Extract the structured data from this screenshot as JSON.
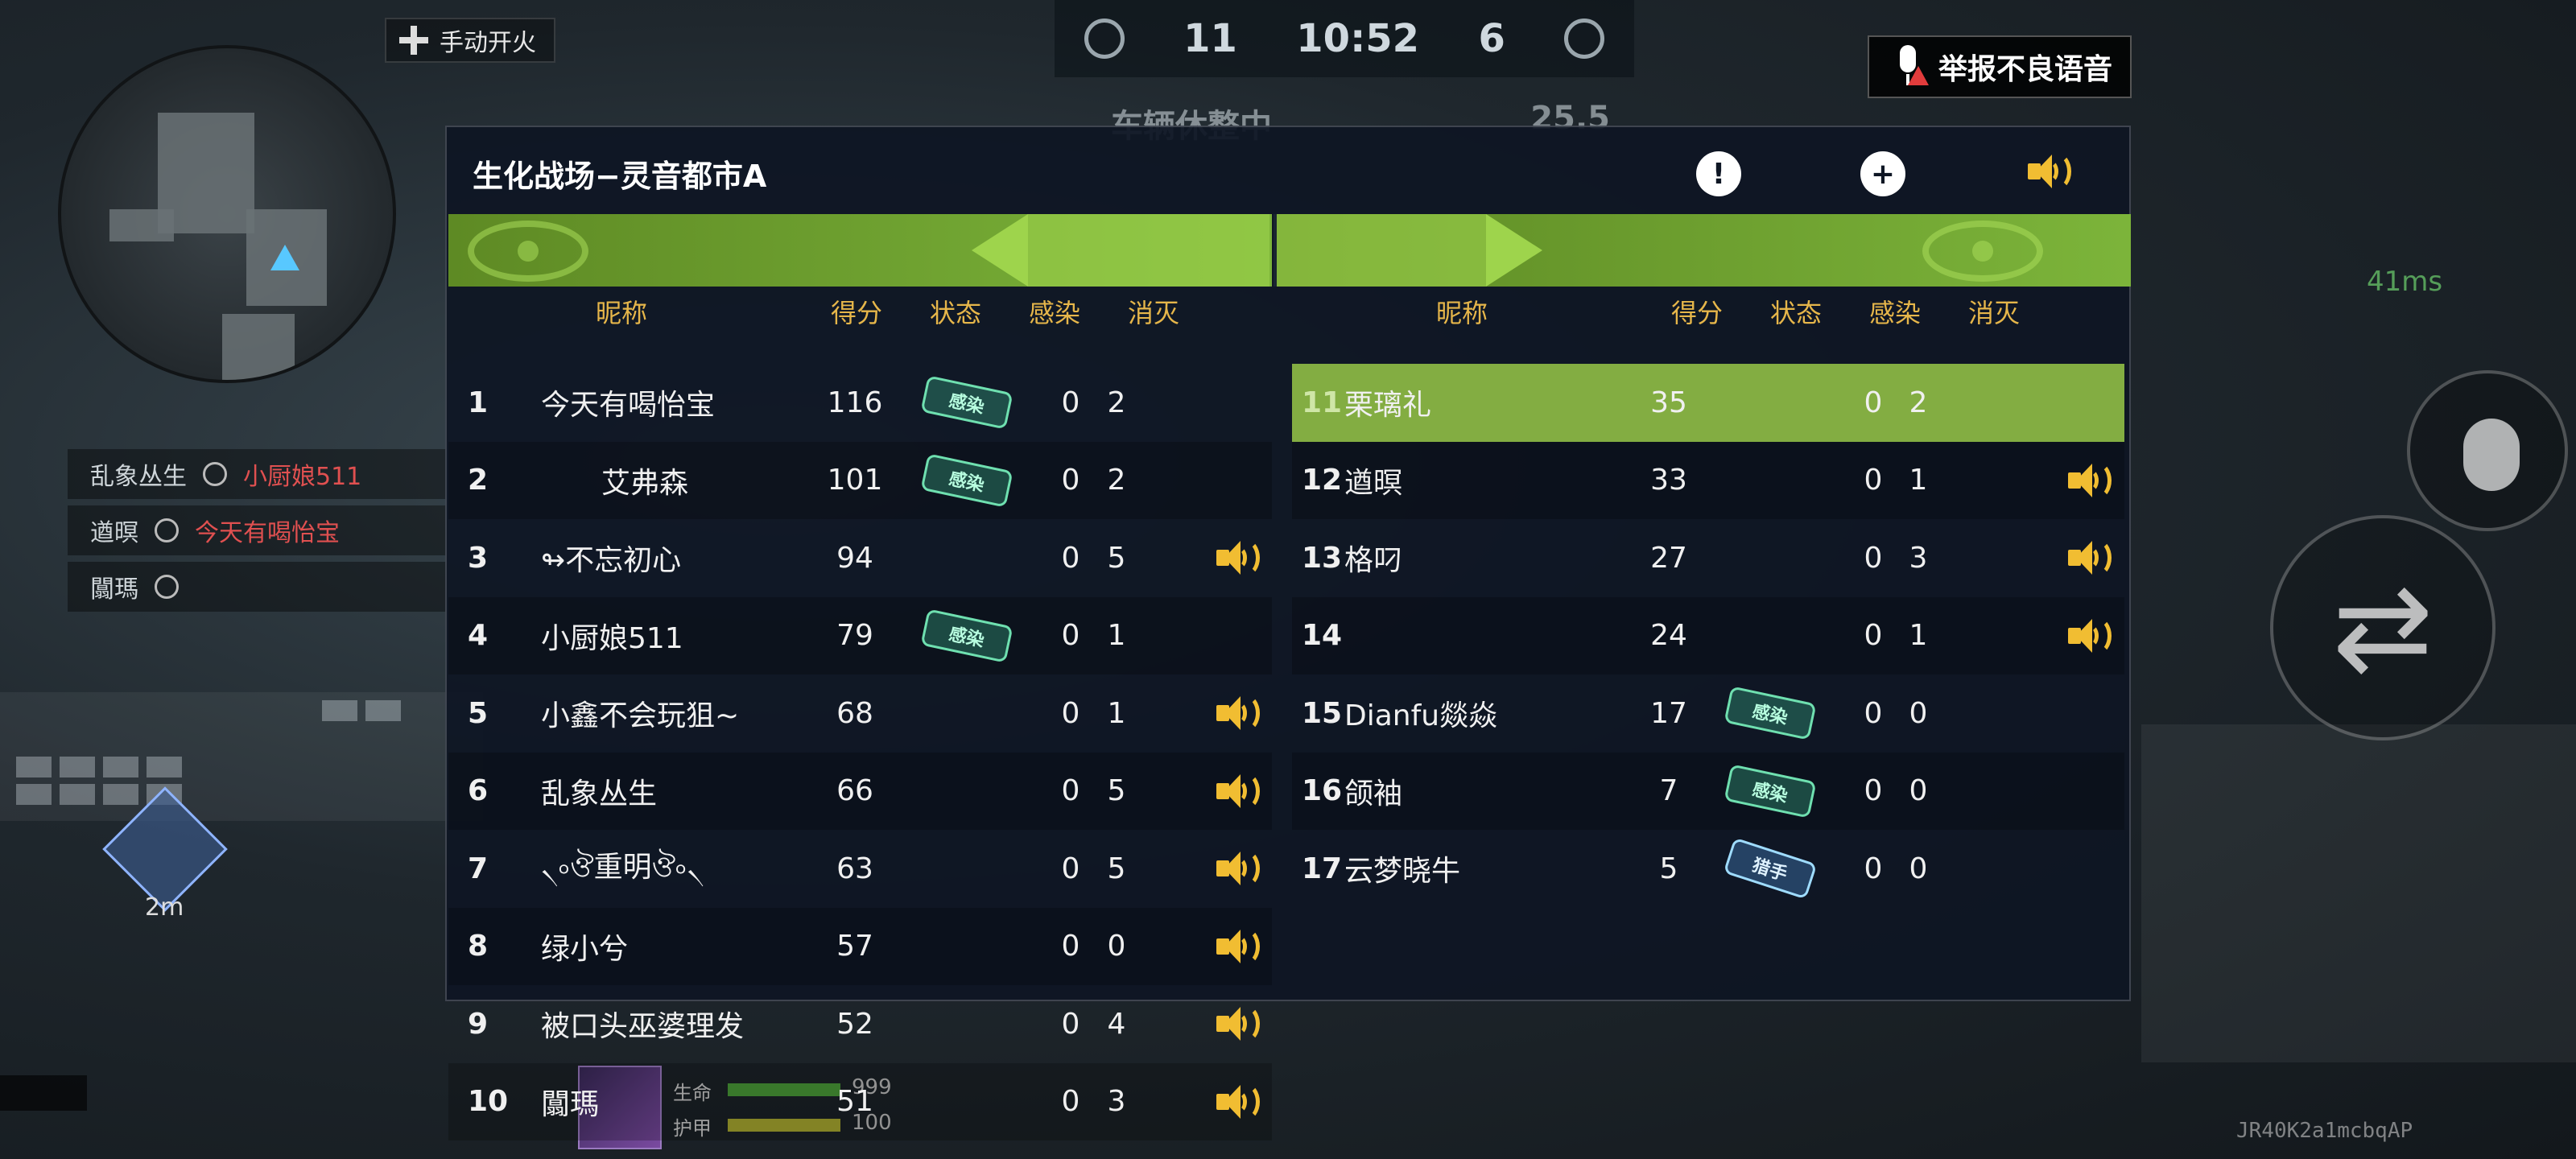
{
  "hud": {
    "manual_fire": "手动开火",
    "top_score_left": "11",
    "timer": "10:52",
    "top_score_right": "6",
    "status_left": "车辆休整中",
    "status_right": "25.5",
    "report_voice": "举报不良语音",
    "killfeed": [
      {
        "killer": "乱象丛生",
        "victim": "小厨娘511"
      },
      {
        "killer": "遒暝",
        "victim": "今天有喝怡宝"
      },
      {
        "killer": "闒瑪",
        "victim": ""
      }
    ],
    "waypoint_distance": "2m",
    "ping": "41ms",
    "health_label": "生命",
    "armor_label": "护甲",
    "health_value": "999",
    "armor_value": "100",
    "player_id": "JR40K2a1mcbqAP"
  },
  "scoreboard": {
    "title": "生化战场−灵音都市A",
    "columns": {
      "name": "昵称",
      "score": "得分",
      "status": "状态",
      "infect": "感染",
      "kill": "消灭"
    },
    "status_badge_text": "感染",
    "status_badge_alt_text": "猎手",
    "colors": {
      "accent": "#83ad42",
      "speaker": "#f1bd32",
      "header_text": "#e6b64a"
    },
    "left_team": [
      {
        "rank": "1",
        "name": "今天有喝怡宝",
        "score": "116",
        "status": "badge",
        "infect": "0",
        "kill": "2",
        "voice": false
      },
      {
        "rank": "2",
        "name": "艾弗森",
        "score": "101",
        "status": "badge",
        "infect": "0",
        "kill": "2",
        "voice": false
      },
      {
        "rank": "3",
        "name": "↬不忘初心",
        "score": "94",
        "status": "",
        "infect": "0",
        "kill": "5",
        "voice": true
      },
      {
        "rank": "4",
        "name": "小厨娘511",
        "score": "79",
        "status": "badge",
        "infect": "0",
        "kill": "1",
        "voice": false
      },
      {
        "rank": "5",
        "name": "小鑫不会玩狙~",
        "score": "68",
        "status": "",
        "infect": "0",
        "kill": "1",
        "voice": true
      },
      {
        "rank": "6",
        "name": "乱象丛生",
        "score": "66",
        "status": "",
        "infect": "0",
        "kill": "5",
        "voice": true
      },
      {
        "rank": "7",
        "name": "৲৹ঔ重明ঔ৹৲",
        "score": "63",
        "status": "",
        "infect": "0",
        "kill": "5",
        "voice": true
      },
      {
        "rank": "8",
        "name": "绿小兮",
        "score": "57",
        "status": "",
        "infect": "0",
        "kill": "0",
        "voice": true
      },
      {
        "rank": "9",
        "name": "被口头巫婆理发",
        "score": "52",
        "status": "",
        "infect": "0",
        "kill": "4",
        "voice": true
      },
      {
        "rank": "10",
        "name": "闒瑪",
        "score": "51",
        "status": "",
        "infect": "0",
        "kill": "3",
        "voice": true
      }
    ],
    "right_team": [
      {
        "rank": "11",
        "name": "栗璃礼",
        "score": "35",
        "status": "",
        "infect": "0",
        "kill": "2",
        "voice": false,
        "highlight": true
      },
      {
        "rank": "12",
        "name": "遒暝",
        "score": "33",
        "status": "",
        "infect": "0",
        "kill": "1",
        "voice": true
      },
      {
        "rank": "13",
        "name": "格叼",
        "score": "27",
        "status": "",
        "infect": "0",
        "kill": "3",
        "voice": true
      },
      {
        "rank": "14",
        "name": "",
        "score": "24",
        "status": "",
        "infect": "0",
        "kill": "1",
        "voice": true
      },
      {
        "rank": "15",
        "name": "Dianfu燚焱",
        "score": "17",
        "status": "badge",
        "infect": "0",
        "kill": "0",
        "voice": false
      },
      {
        "rank": "16",
        "name": "颌袖",
        "score": "7",
        "status": "badge",
        "infect": "0",
        "kill": "0",
        "voice": false
      },
      {
        "rank": "17",
        "name": "云梦晓牛",
        "score": "5",
        "status": "badge-alt",
        "infect": "0",
        "kill": "0",
        "voice": false
      }
    ]
  }
}
